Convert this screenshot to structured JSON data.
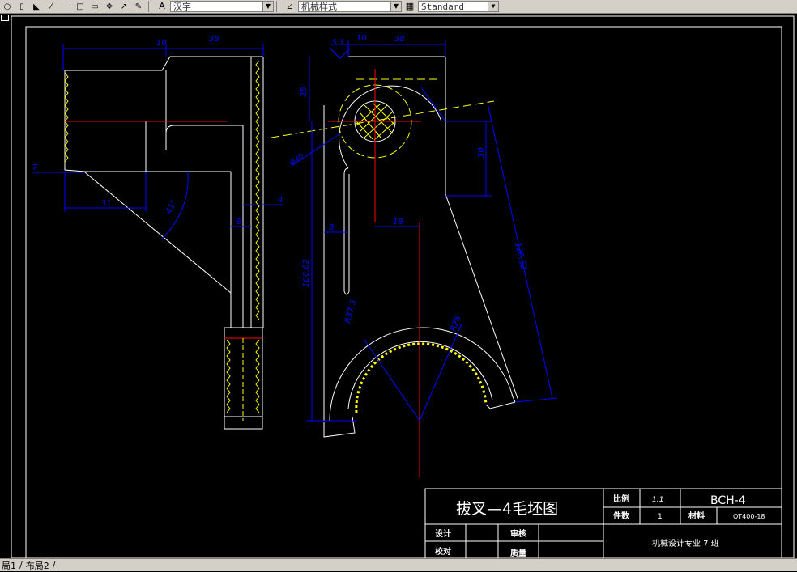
{
  "toolbar": {
    "font_combo": "汉字",
    "dimstyle_combo": "机械样式",
    "textstyle_combo": "Standard",
    "icons": [
      "circle-icon",
      "rect-icon",
      "triangle-icon",
      "line-icon",
      "dashed-line-icon",
      "square-icon",
      "square2-icon",
      "move-icon",
      "curve-icon",
      "pen-icon",
      "text-style-icon",
      "dim-style-icon",
      "table-style-icon"
    ]
  },
  "tabs": {
    "layout1": "局1",
    "layout2": "布局2"
  },
  "dimensions": {
    "left_top_small": "10",
    "left_top": "38",
    "left_seven": "7",
    "left_31": "31",
    "left_angle": "41°",
    "left_8": "8",
    "left_4": "4",
    "mid_53": "5.3",
    "mid_10": "10",
    "mid_38": "38",
    "mid_25": "25",
    "mid_dia": "Φ40",
    "mid_30": "30",
    "mid_18": "18",
    "mid_8": "8",
    "mid_height": "106.62",
    "mid_r_left": "R37.5",
    "mid_r_right": "R28",
    "right_long": "120.62"
  },
  "title_block": {
    "title": "拔叉—4毛坯图",
    "scale_label": "比例",
    "scale_value": "1:1",
    "code": "BCH-4",
    "count_label": "件数",
    "count_value": "1",
    "material_label": "材料",
    "material_value": "QT400-18",
    "design_label": "设计",
    "review_label": "审核",
    "check_label": "校对",
    "quality_label": "质量",
    "dept": "机械设计专业 7 班"
  }
}
